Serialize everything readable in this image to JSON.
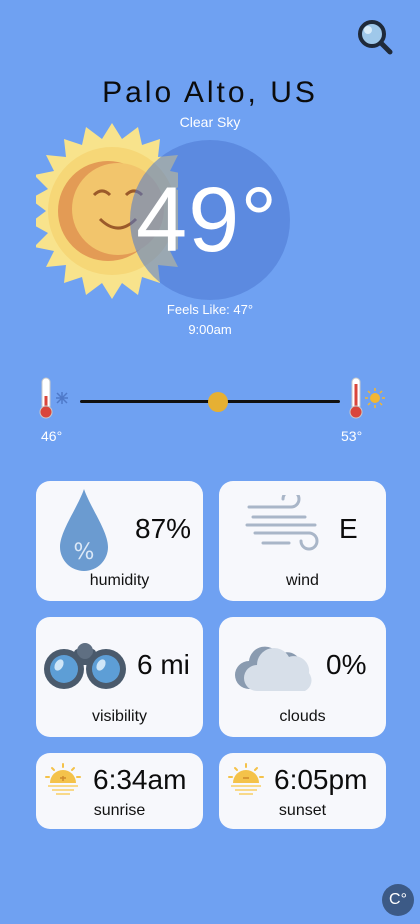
{
  "location": {
    "city": "Palo Alto, US",
    "condition": "Clear Sky"
  },
  "current": {
    "temp": "49°",
    "feels_like": "Feels Like: 47°",
    "time": "9:00am"
  },
  "range": {
    "low": "46°",
    "high": "53°",
    "position": 0.5
  },
  "cards": [
    {
      "key": "humidity",
      "value": "87%",
      "label": "humidity",
      "icon": "humidity-drop-icon"
    },
    {
      "key": "wind",
      "value": "E",
      "label": "wind",
      "icon": "wind-icon"
    },
    {
      "key": "visibility",
      "value": "6 mi",
      "label": "visibility",
      "icon": "binoculars-icon"
    },
    {
      "key": "clouds",
      "value": "0%",
      "label": "clouds",
      "icon": "cloud-icon"
    },
    {
      "key": "sunrise",
      "value": "6:34am",
      "label": "sunrise",
      "icon": "sunrise-icon"
    },
    {
      "key": "sunset",
      "value": "6:05pm",
      "label": "sunset",
      "icon": "sunset-icon"
    }
  ],
  "unit_toggle": "C°",
  "colors": {
    "background": "#6fa1f2",
    "card": "#f7f8fc",
    "sun": "#f6dc7c",
    "thumb": "#e6b033"
  }
}
